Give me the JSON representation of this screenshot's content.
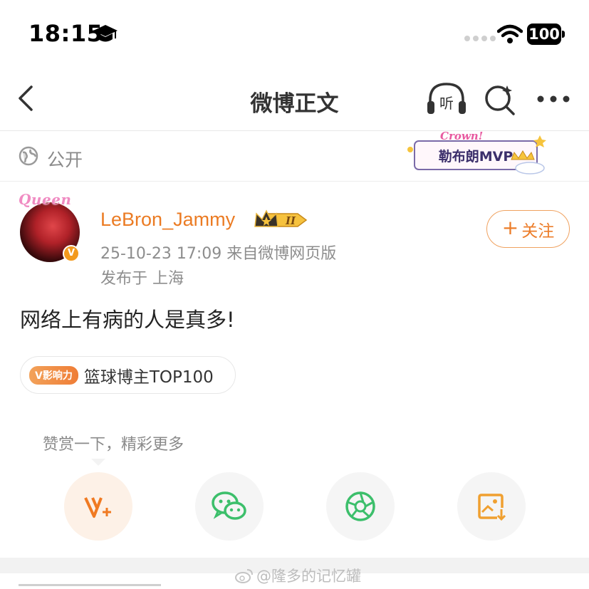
{
  "status_bar": {
    "time": "18:15",
    "battery": "100"
  },
  "nav": {
    "title": "微博正文",
    "listen_label": "听"
  },
  "visibility": {
    "label": "公开",
    "badge_script": "Crown!",
    "badge_text": "勒布朗MVP"
  },
  "post": {
    "avatar_overlay": "Queen",
    "verified_mark": "V",
    "username": "LeBron_Jammy",
    "vip_level": "II",
    "meta": "25-10-23 17:09   来自微博网页版",
    "location": "发布于 上海",
    "follow_label": "关注",
    "text": "网络上有病的人是真多!",
    "influence_badge": "V影响力",
    "influence_label": "篮球博主TOP100"
  },
  "share": {
    "reward_tip": "赞赏一下，精彩更多",
    "buttons": [
      "reward-icon",
      "wechat-icon",
      "moments-icon",
      "save-image-icon"
    ]
  },
  "watermark": "@隆多的记忆罐",
  "colors": {
    "accent_orange": "#eb7b23",
    "wechat_green": "#3cbf6b",
    "save_orange": "#f0a030"
  }
}
